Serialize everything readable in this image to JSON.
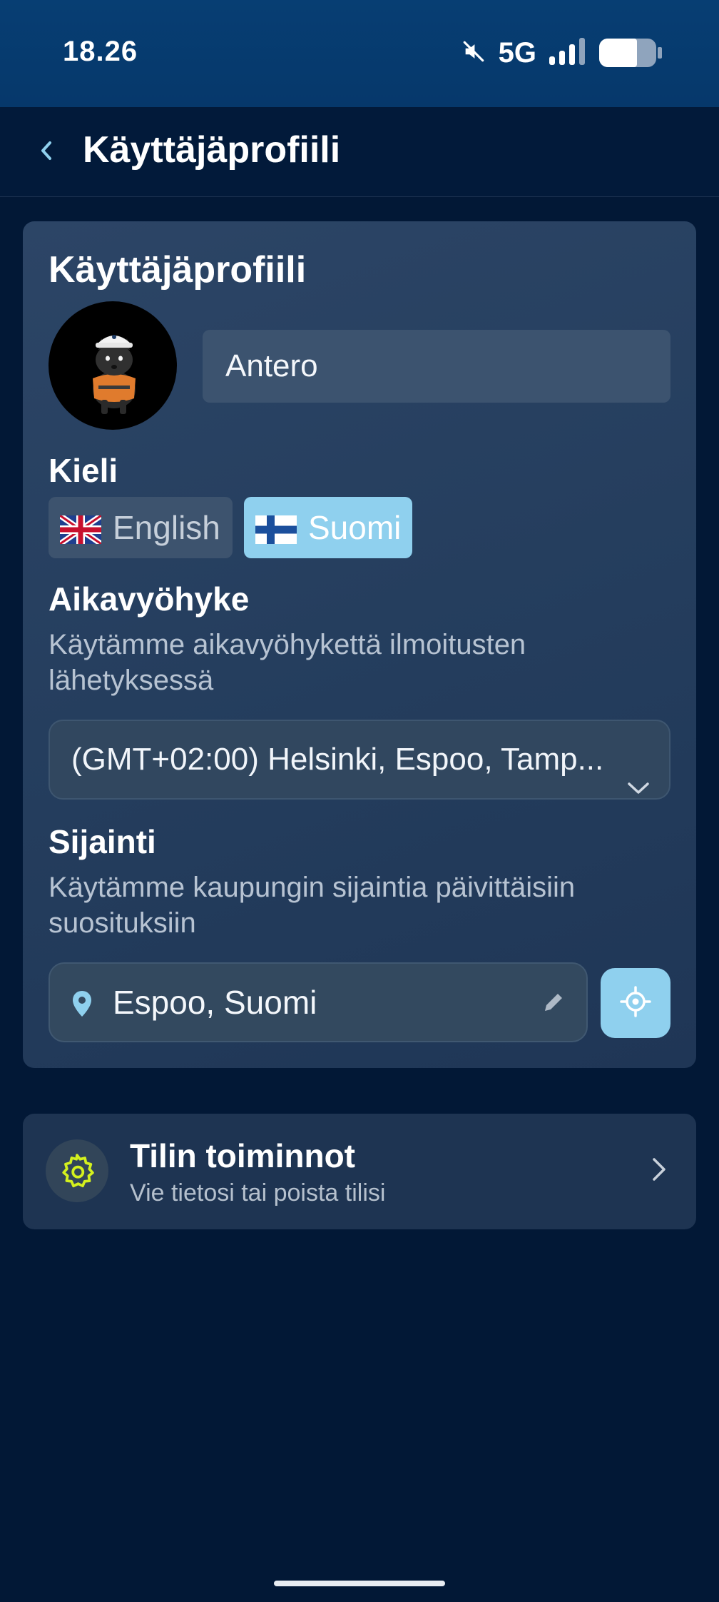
{
  "status_bar": {
    "time": "18.26",
    "network": "5G",
    "icons": [
      "mute-icon",
      "signal-icon",
      "battery-icon"
    ],
    "battery_percent": 66
  },
  "app_bar": {
    "title": "Käyttäjäprofiili",
    "back_icon": "chevron-left-icon"
  },
  "profile": {
    "title": "Käyttäjäprofiili",
    "name_value": "Antero",
    "language": {
      "label": "Kieli",
      "options": [
        {
          "label": "English",
          "flag": "uk-flag-icon",
          "selected": false
        },
        {
          "label": "Suomi",
          "flag": "finland-flag-icon",
          "selected": true
        }
      ]
    },
    "timezone": {
      "label": "Aikavyöhyke",
      "helper": "Käytämme aikavyöhykettä ilmoitusten lähetyksessä",
      "value": "(GMT+02:00) Helsinki, Espoo, Tamp..."
    },
    "location": {
      "label": "Sijainti",
      "helper": "Käytämme kaupungin sijaintia päivittäisiin suosituksiin",
      "value": "Espoo, Suomi"
    }
  },
  "account_actions": {
    "title": "Tilin toiminnot",
    "subtitle": "Vie tietosi tai poista tilisi"
  },
  "colors": {
    "background": "#021836",
    "card": "#2a4262",
    "accent": "#8fd0ee",
    "gear": "#d4f01e"
  }
}
